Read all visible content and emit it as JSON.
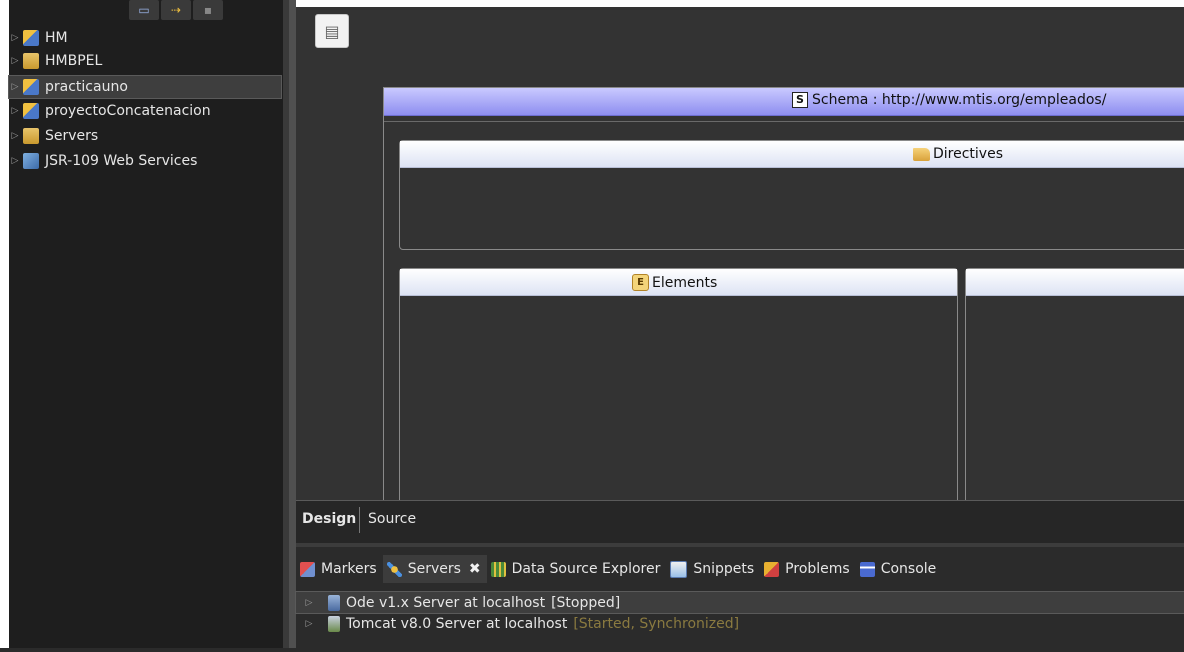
{
  "explorer": {
    "items": [
      {
        "label": "HM",
        "icon": "web-project-icon"
      },
      {
        "label": "HMBPEL",
        "icon": "bpel-project-icon"
      },
      {
        "label": "practicauno",
        "icon": "web-project-icon"
      },
      {
        "label": "proyectoConcatenacion",
        "icon": "web-project-icon"
      },
      {
        "label": "Servers",
        "icon": "folder-icon"
      },
      {
        "label": "JSR-109 Web Services",
        "icon": "web-services-icon"
      }
    ]
  },
  "editor": {
    "schema_label": "Schema : http://www.mtis.org/empleados/",
    "schema_badge": "S",
    "directives_label": "Directives",
    "elements_label": "Elements",
    "elements_badge": "E",
    "tabs": {
      "design": "Design",
      "source": "Source"
    }
  },
  "bottom": {
    "tabs": [
      {
        "label": "Markers",
        "icon": "markers-icon"
      },
      {
        "label": "Servers",
        "icon": "servers-icon",
        "active": true
      },
      {
        "label": "Data Source Explorer",
        "icon": "data-source-explorer-icon"
      },
      {
        "label": "Snippets",
        "icon": "snippets-icon"
      },
      {
        "label": "Problems",
        "icon": "problems-icon"
      },
      {
        "label": "Console",
        "icon": "console-icon"
      }
    ],
    "close_glyph": "✖",
    "servers": [
      {
        "name": "Ode v1.x Server at localhost",
        "state": "[Stopped]"
      },
      {
        "name": "Tomcat v8.0 Server at localhost",
        "state": "[Started, Synchronized]"
      }
    ]
  },
  "colors": {
    "schema_header": "#8e8ef0",
    "started_state": "#8a7a40",
    "background": "#2b2b2b"
  }
}
